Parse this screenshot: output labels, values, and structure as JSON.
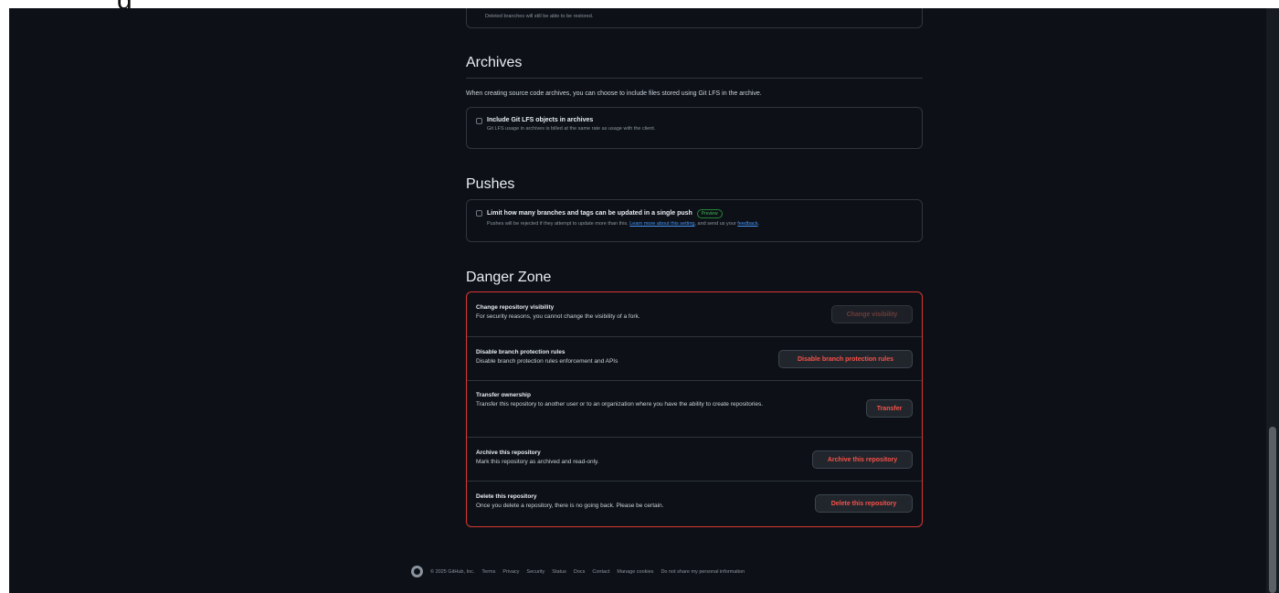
{
  "branches": {
    "note": "Deleted branches will still be able to be restored."
  },
  "archives": {
    "heading": "Archives",
    "description": "When creating source code archives, you can choose to include files stored using Git LFS in the archive.",
    "option_label": "Include Git LFS objects in archives",
    "option_desc": "Git LFS usage in archives is billed at the same rate as usage with the client."
  },
  "pushes": {
    "heading": "Pushes",
    "option_label": "Limit how many branches and tags can be updated in a single push",
    "badge": "Preview",
    "desc_prefix": "Pushes will be rejected if they attempt to update more than this.",
    "learn_more": "Learn more about this setting",
    "desc_middle": ", and send us your ",
    "feedback": "feedback",
    "desc_suffix": "."
  },
  "danger": {
    "heading": "Danger Zone",
    "items": [
      {
        "title": "Change repository visibility",
        "desc": "For security reasons, you cannot change the visibility of a fork.",
        "button": "Change visibility"
      },
      {
        "title": "Disable branch protection rules",
        "desc": "Disable branch protection rules enforcement and APIs",
        "button": "Disable branch protection rules"
      },
      {
        "title": "Transfer ownership",
        "desc": "Transfer this repository to another user or to an organization where you have the ability to create repositories.",
        "button": "Transfer"
      },
      {
        "title": "Archive this repository",
        "desc": "Mark this repository as archived and read-only.",
        "button": "Archive this repository"
      },
      {
        "title": "Delete this repository",
        "desc": "Once you delete a repository, there is no going back. Please be certain.",
        "button": "Delete this repository"
      }
    ]
  },
  "footer": {
    "copyright": "© 2025 GitHub, Inc.",
    "links": [
      "Terms",
      "Privacy",
      "Security",
      "Status",
      "Docs",
      "Contact",
      "Manage cookies",
      "Do not share my personal information"
    ]
  },
  "colors": {
    "background": "#0d1117",
    "border": "#30363d",
    "danger": "#da3633",
    "danger_text": "#f85149",
    "link": "#4493f8",
    "preview_green": "#3fb950"
  }
}
